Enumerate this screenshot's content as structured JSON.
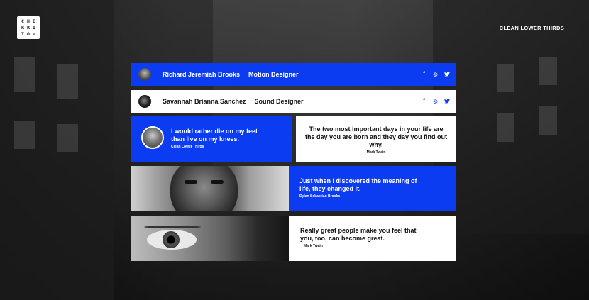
{
  "logo": {
    "letters": [
      "C",
      "H",
      "E",
      "R",
      "R",
      "I",
      "T",
      "O",
      "-"
    ]
  },
  "header": {
    "title": "CLEAN LOWER THIRDS"
  },
  "bars": [
    {
      "name": "Richard Jeremiah Brooks",
      "role": "Motion Designer"
    },
    {
      "name": "Savannah Brianna Sanchez",
      "role": "Sound Designer"
    }
  ],
  "socials": {
    "facebook": "f",
    "instagram": "◎",
    "twitter": "🐦"
  },
  "quotes": [
    {
      "text": "I would rather die on my feet than live on my knees.",
      "author": "Clean Lower Thirds"
    },
    {
      "text": "The two most important days in your  life are the day you are born and they day you find out why.",
      "author": "Mark Twain"
    },
    {
      "text": "Just when I discovered the meaning of life, they changed it.",
      "author": "Dylan Sebastian Brooks"
    },
    {
      "text": "Really great people make you feel that you, too, can become great.",
      "author": "Mark Twain"
    }
  ],
  "colors": {
    "accent": "#0b3cf2",
    "panel": "#ffffff"
  }
}
